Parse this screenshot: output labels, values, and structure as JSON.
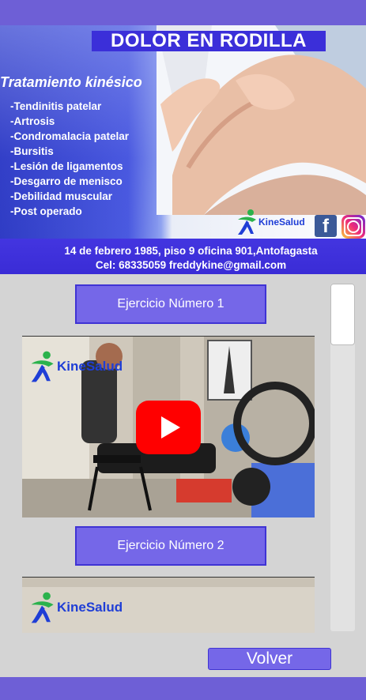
{
  "banner": {
    "title": "DOLOR EN RODILLA",
    "subtitle": "Tratamiento kinésico",
    "conditions": [
      "-Tendinitis patelar",
      "-Artrosis",
      "-Condromalacia patelar",
      "-Bursitis",
      "-Lesión de ligamentos",
      "-Desgarro de menisco",
      "-Debilidad muscular",
      "-Post operado"
    ],
    "brand": "KineSalud",
    "address": "14 de febrero 1985, piso 9 oficina 901,Antofagasta",
    "phone": "Cel: 68335059 freddykine@gmail.com"
  },
  "exercises": [
    {
      "label": "Ejercicio Número 1",
      "video_brand": "KineSalud"
    },
    {
      "label": "Ejercicio Número 2",
      "video_brand": "KineSalud"
    }
  ],
  "actions": {
    "back_label": "Volver"
  },
  "colors": {
    "accent": "#7567e8",
    "bar": "#6e5fd6",
    "title_bg": "#3b2fd9",
    "play": "#ff0000"
  }
}
